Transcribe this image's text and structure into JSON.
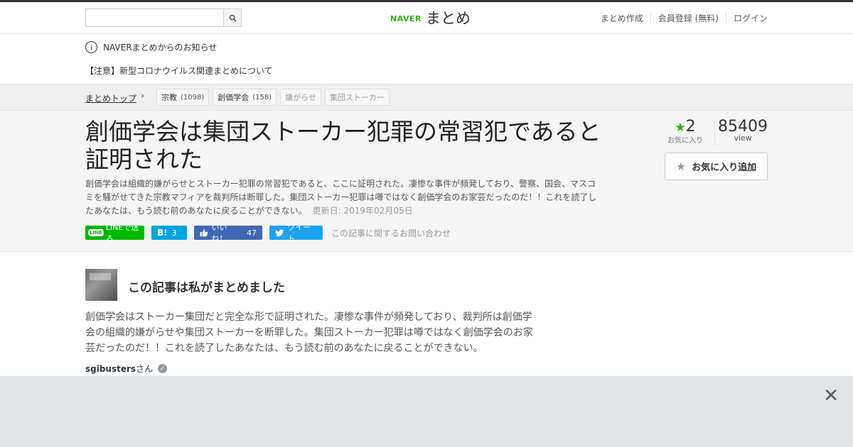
{
  "header": {
    "search_placeholder": "",
    "logo_naver": "NAVER",
    "logo_matome": "まとめ",
    "nav": [
      "まとめ作成",
      "会員登録 (無料)",
      "ログイン"
    ]
  },
  "notice": {
    "title": "NAVERまとめからのお知らせ",
    "item": "【注意】新型コロナウイルス関連まとめについて"
  },
  "breadcrumb": {
    "top": "まとめトップ",
    "tags": [
      {
        "label": "宗教",
        "count": "(1098)"
      },
      {
        "label": "創価学会",
        "count": "(158)"
      },
      {
        "label": "嫌がらせ",
        "count": ""
      },
      {
        "label": "集団ストーカー",
        "count": ""
      }
    ]
  },
  "article": {
    "title": "創価学会は集団ストーカー犯罪の常習犯であると証明された",
    "description": "創価学会は組織的嫌がらせとストーカー犯罪の常習犯であると、ここに証明された。凄惨な事件が頻発しており、警察、国会、マスコミを騒がせてきた宗教マフィアを裁判所は断罪した。集団ストーカー犯罪は噂ではなく創価学会のお家芸だったのだ！！これを読了したあなたは、もう読む前のあなたに戻ることができない。",
    "updated": "更新日: 2019年02月05日",
    "share": {
      "line": "LINEで送る",
      "line_logo": "LINE",
      "hatena_icon": "B!",
      "hatena_count": "3",
      "fb": "いいね！",
      "fb_count": "47",
      "tw": "ツイート",
      "inquiry": "この記事に関するお問い合わせ"
    },
    "favorites": "2",
    "favorites_label": "お気に入り",
    "views": "85409",
    "views_label": "view",
    "fav_button": "お気に入り追加"
  },
  "author": {
    "heading": "この記事は私がまとめました",
    "body": "創価学会はストーカー集団だと完全な形で証明された。凄惨な事件が頻発しており、裁判所は創価学会の組織的嫌がらせや集団ストーカーを断罪した。集団ストーカー犯罪は噂ではなく創価学会のお家芸だったのだ！！これを読了したあなたは、もう読む前のあなたに戻ることができない。",
    "username": "sgibusters",
    "suffix": "さん"
  },
  "colors": {
    "naver_green": "#2db400",
    "line": "#00b900",
    "hatena": "#00a4de",
    "facebook": "#4267b2",
    "twitter": "#1da1f2"
  }
}
